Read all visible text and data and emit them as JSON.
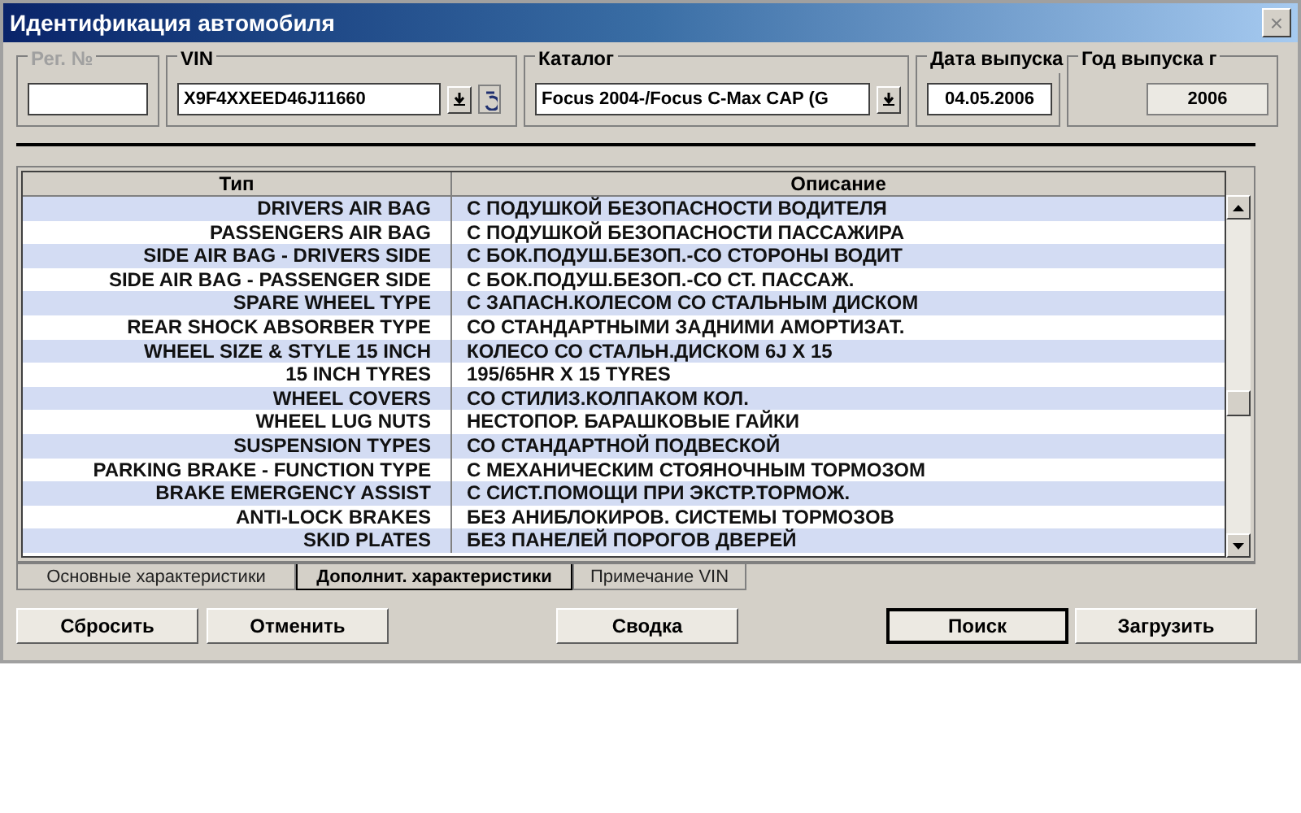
{
  "window": {
    "title": "Идентификация автомобиля",
    "close": "×"
  },
  "fields": [
    {
      "label": "Рег. №",
      "disabled": true
    },
    {
      "label": "VIN",
      "value": "X9F4XXEED46J11660",
      "disabled": false,
      "kind": "vin"
    },
    {
      "label": "Каталог",
      "value": "Focus 2004-/Focus C-Max CAP (G",
      "disabled": false,
      "kind": "combo"
    },
    {
      "label": "Дата выпуска",
      "value": "04.05.2006",
      "disabled": false,
      "kind": "text"
    },
    {
      "label": "Год выпуска г",
      "value": "2006",
      "disabled": false,
      "kind": "readonly"
    }
  ],
  "table": {
    "columns": [
      "Тип",
      "Описание"
    ],
    "rows": [
      [
        "DRIVERS AIR BAG",
        "С ПОДУШКОЙ БЕЗОПАСНОСТИ ВОДИТЕЛЯ"
      ],
      [
        "PASSENGERS AIR BAG",
        "С ПОДУШКОЙ БЕЗОПАСНОСТИ ПАССАЖИРА"
      ],
      [
        "SIDE AIR BAG - DRIVERS SIDE",
        "С БОК.ПОДУШ.БЕЗОП.-СО СТОРОНЫ ВОДИТ"
      ],
      [
        "SIDE AIR BAG - PASSENGER SIDE",
        "С БОК.ПОДУШ.БЕЗОП.-СО СТ. ПАССАЖ."
      ],
      [
        "SPARE WHEEL TYPE",
        "С ЗАПАСН.КОЛЕСОМ СО СТАЛЬНЫМ ДИСКОМ"
      ],
      [
        "REAR SHOCK ABSORBER TYPE",
        "СО СТАНДАРТНЫМИ ЗАДНИМИ АМОРТИЗАТ."
      ],
      [
        "WHEEL SIZE & STYLE 15 INCH",
        "КОЛЕСО СО СТАЛЬН.ДИСКОМ 6J X 15"
      ],
      [
        "15 INCH TYRES",
        "195/65HR X 15 TYRES"
      ],
      [
        "WHEEL COVERS",
        "СО СТИЛИЗ.КОЛПАКОМ КОЛ."
      ],
      [
        "WHEEL LUG NUTS",
        "НЕСТОПОР. БАРАШКОВЫЕ ГАЙКИ"
      ],
      [
        "SUSPENSION TYPES",
        "СО СТАНДАРТНОЙ ПОДВЕСКОЙ"
      ],
      [
        "PARKING BRAKE - FUNCTION TYPE",
        "С МЕХАНИЧЕСКИМ СТОЯНОЧНЫМ ТОРМОЗОМ"
      ],
      [
        "BRAKE EMERGENCY ASSIST",
        "С СИСТ.ПОМОЩИ ПРИ ЭКСТР.ТОРМОЖ."
      ],
      [
        "ANTI-LOCK BRAKES",
        "БЕЗ АНИБЛОКИРОВ. СИСТЕМЫ ТОРМОЗОВ"
      ],
      [
        "SKID PLATES",
        "БЕЗ ПАНЕЛЕЙ ПОРОГОВ ДВЕРЕЙ"
      ]
    ]
  },
  "tabs": [
    {
      "label": "Основные характеристики",
      "selected": false
    },
    {
      "label": "Дополнит. характеристики",
      "selected": true
    },
    {
      "label": "Примечание VIN",
      "selected": false
    }
  ],
  "buttons": [
    {
      "label": "Сбросить",
      "default": false
    },
    {
      "label": "Отменить",
      "default": false
    },
    {
      "label": "Сводка",
      "default": false
    },
    {
      "label": "Поиск",
      "default": true
    },
    {
      "label": "Загрузить",
      "default": false
    }
  ]
}
